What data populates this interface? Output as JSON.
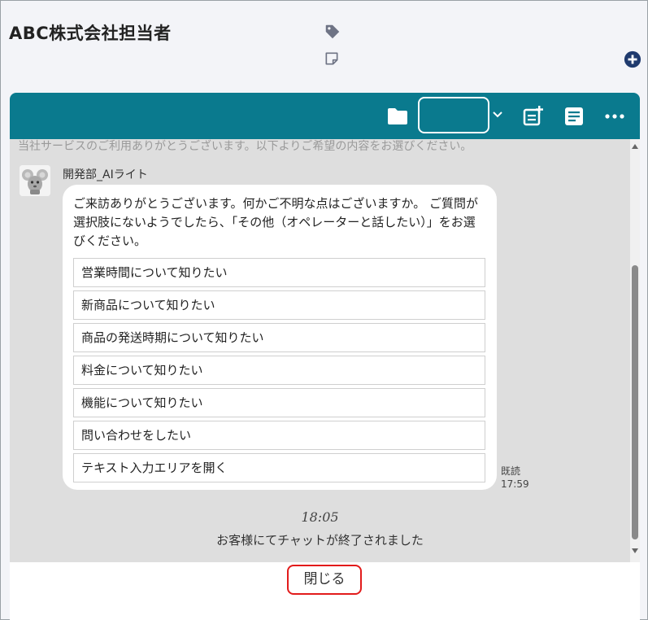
{
  "header": {
    "title": "ABC株式会社担当者",
    "icons": {
      "tag": "tag-icon",
      "note": "note-icon",
      "add": "plus-circle-icon"
    }
  },
  "toolbar": {
    "icons": [
      "folder-icon",
      "chevron-down-icon",
      "add-note-icon",
      "document-icon",
      "more-icon"
    ],
    "select_value": ""
  },
  "chat": {
    "faded_text": "当社サービスのご利用ありがとうございます。以下よりご希望の内容をお選びください。",
    "sender": "開発部_AIライト",
    "message": "ご来訪ありがとうございます。何かご不明な点はございますか。 ご質問が選択肢にないようでしたら、「その他（オペレーターと話したい）」をお選びください。",
    "options": [
      "営業時間について知りたい",
      "新商品について知りたい",
      "商品の発送時期について知りたい",
      "料金について知りたい",
      "機能について知りたい",
      "問い合わせをしたい",
      "テキスト入力エリアを開く"
    ],
    "read_label": "既読",
    "read_time": "17:59",
    "end_time": "18:05",
    "end_message": "お客様にてチャットが終了されました"
  },
  "footer": {
    "close_label": "閉じる"
  },
  "colors": {
    "toolbar": "#0a7a8e",
    "highlight": "#e21b1b",
    "chat_bg": "#dedede",
    "plus": "#1f3a6e"
  }
}
